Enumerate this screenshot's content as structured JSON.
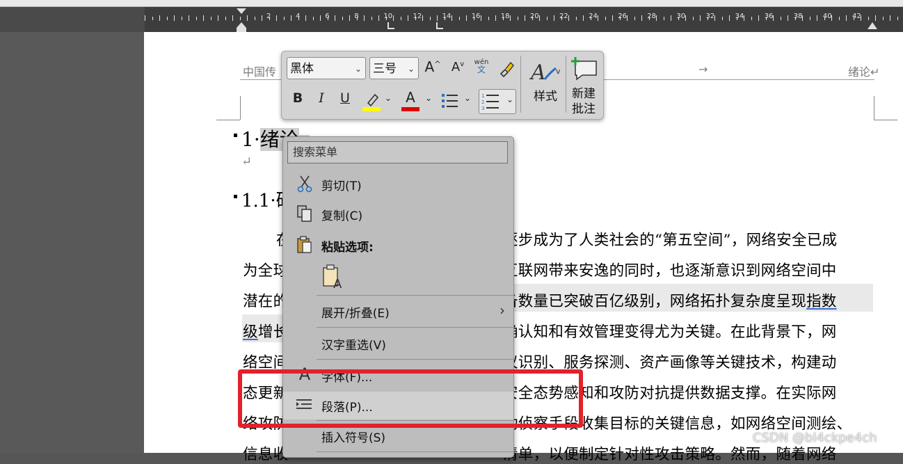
{
  "ruler": {
    "numbers": [
      "2",
      "4",
      "6",
      "8",
      "10",
      "12",
      "14",
      "16",
      "18",
      "20",
      "22",
      "24",
      "26",
      "28",
      "30",
      "32",
      "34",
      "36",
      "38",
      "40",
      "42"
    ]
  },
  "document": {
    "header_left": "中国传",
    "header_arrow": "→",
    "header_right": "绪论↵",
    "heading1_num": "1·",
    "heading1_text": "绪论",
    "heading1_mark": "↵",
    "empty_para_mark": "↵",
    "heading2_num": "1.1·",
    "heading2_text": "研",
    "lines": [
      {
        "left": "在",
        "right": "逐步成为了人类社会的“第五空间”，网络安全已成"
      },
      {
        "left": "为全球",
        "right": "互联网带来安逸的同时，也逐渐意识到网络空间中"
      },
      {
        "left": "潜在的",
        "right": "备数量已突破百亿级别，网络拓扑复杂度呈现",
        "right_u": "指数"
      },
      {
        "left_u": "级",
        "left": "增长",
        "right": "确认知和有效管理变得尤为关键。在此背景下，网"
      },
      {
        "left": "络空间",
        "right": "议识别、服务探测、资产画像等关键技术，构建动"
      },
      {
        "left": "态更新",
        "right": "安全态势感知和攻防对抗提供数据支撑。在实际网"
      },
      {
        "left": "络攻防",
        "right": "动侦察手段收集目标的关键信息，如网络空间测绘、"
      },
      {
        "left": "信息收",
        "right": "清单，以便制定针对性攻击策略。然而，随着网络"
      }
    ]
  },
  "mini_toolbar": {
    "font_name": "黑体",
    "font_size": "三号",
    "grow_font": "A",
    "shrink_font": "A",
    "phonetic_top": "wén",
    "phonetic_bottom": "文",
    "bold": "B",
    "italic": "I",
    "underline": "U",
    "font_color_letter": "A",
    "styles_label": "样式",
    "new_comment_label_1": "新建",
    "new_comment_label_2": "批注",
    "highlight_color": "#ffff00",
    "font_color": "#e00000"
  },
  "context_menu": {
    "search_placeholder": "搜索菜单",
    "items": [
      {
        "label": "剪切(T)",
        "icon": "scissors-icon"
      },
      {
        "label": "复制(C)",
        "icon": "copy-icon"
      },
      {
        "label": "粘贴选项:",
        "icon": "paste-icon"
      },
      {
        "label": "展开/折叠(E)",
        "icon": "",
        "submenu": true
      },
      {
        "label": "汉字重选(V)",
        "icon": ""
      },
      {
        "label": "字体(F)...",
        "icon": "font-icon"
      },
      {
        "label": "段落(P)...",
        "icon": "paragraph-icon"
      },
      {
        "label": "插入符号(S)",
        "icon": ""
      }
    ]
  },
  "highlight_color": "#e3212b",
  "watermark": "CSDN @bl4ckpe4ch"
}
